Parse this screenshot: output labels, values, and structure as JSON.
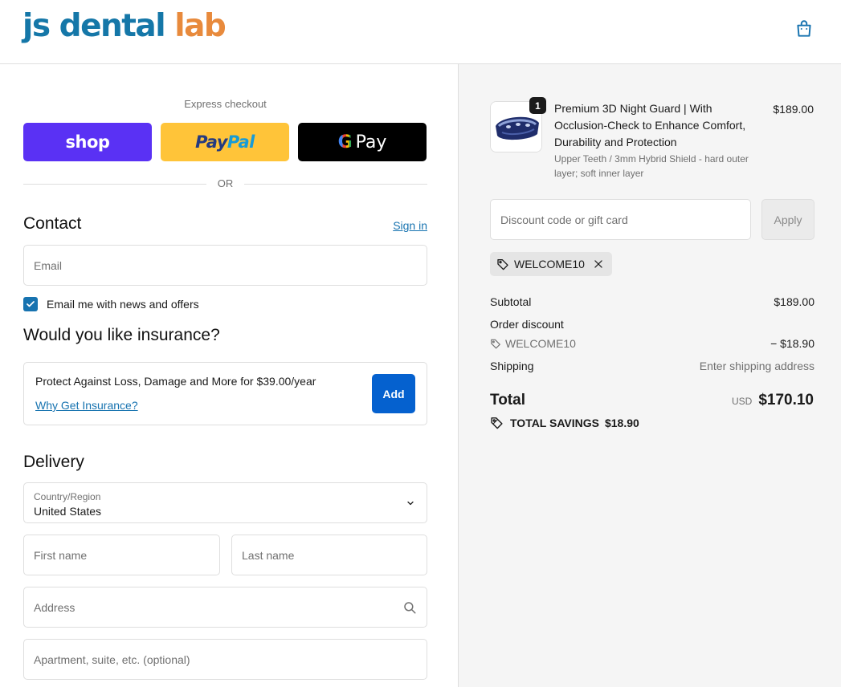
{
  "header": {
    "logo_part1": "js dental ",
    "logo_part2": "lab",
    "cart_icon": "shopping-bag-icon"
  },
  "express": {
    "title": "Express checkout",
    "shop_label": "shop",
    "paypal_label_1": "Pay",
    "paypal_label_2": "Pal",
    "gpay_g": "G",
    "gpay_label": "Pay",
    "or_label": "OR"
  },
  "contact": {
    "title": "Contact",
    "signin_label": "Sign in",
    "email_placeholder": "Email",
    "newsletter_label": "Email me with news and offers",
    "newsletter_checked": true
  },
  "insurance": {
    "title": "Would you like insurance?",
    "text": "Protect Against Loss, Damage and More for $39.00/year",
    "link": "Why Get Insurance?",
    "add_label": "Add"
  },
  "delivery": {
    "title": "Delivery",
    "country_label": "Country/Region",
    "country_value": "United States",
    "first_name_placeholder": "First name",
    "last_name_placeholder": "Last name",
    "address_placeholder": "Address",
    "apartment_placeholder": "Apartment, suite, etc. (optional)"
  },
  "summary": {
    "product": {
      "quantity": "1",
      "name": "Premium 3D Night Guard | With Occlusion-Check to Enhance Comfort, Durability and Protection",
      "variant": "Upper Teeth / 3mm Hybrid Shield - hard outer layer; soft inner layer",
      "price": "$189.00"
    },
    "discount_placeholder": "Discount code or gift card",
    "apply_label": "Apply",
    "applied_code": "WELCOME10",
    "subtotal_label": "Subtotal",
    "subtotal_value": "$189.00",
    "order_discount_label": "Order discount",
    "discount_code": "WELCOME10",
    "discount_value": "− $18.90",
    "shipping_label": "Shipping",
    "shipping_value": "Enter shipping address",
    "total_label": "Total",
    "currency": "USD",
    "total_value": "$170.10",
    "savings_label": "TOTAL SAVINGS",
    "savings_value": "$18.90"
  },
  "colors": {
    "accent_blue": "#1773b0",
    "button_blue": "#0561cf",
    "shop_purple": "#5a31f4",
    "paypal_yellow": "#ffc439",
    "logo_blue": "#1577a8",
    "logo_orange": "#e88a3c"
  }
}
